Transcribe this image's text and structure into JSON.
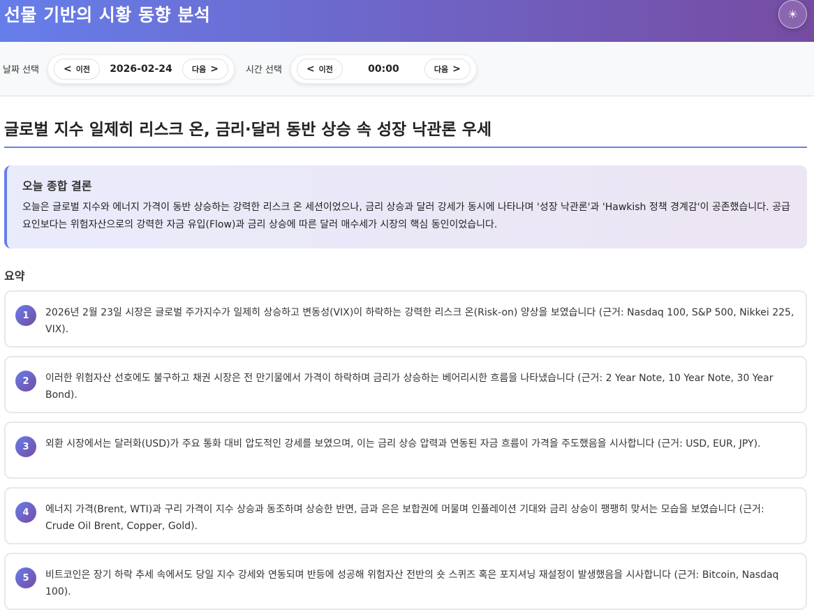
{
  "header": {
    "title": "선물 기반의 시황 동향 분석",
    "theme_icon": "sun-icon"
  },
  "controls": {
    "date_label": "날짜 선택",
    "date_value": "2026-02-24",
    "time_label": "시간 선택",
    "time_value": "00:00",
    "prev": "이전",
    "next": "다음",
    "prev_arrow": "<",
    "next_arrow": ">"
  },
  "main": {
    "title": "글로벌 지수 일제히 리스크 온, 금리·달러 동반 상승 속 성장 낙관론 우세",
    "conclusion": {
      "heading": "오늘 종합 결론",
      "text": "오늘은 글로벌 지수와 에너지 가격이 동반 상승하는 강력한 리스크 온 세션이었으나, 금리 상승과 달러 강세가 동시에 나타나며 '성장 낙관론'과 'Hawkish 정책 경계감'이 공존했습니다. 공급 요인보다는 위험자산으로의 강력한 자금 유입(Flow)과 금리 상승에 따른 달러 매수세가 시장의 핵심 동인이었습니다."
    },
    "summary_title": "요약",
    "summary": [
      {
        "n": "1",
        "text": "2026년 2월 23일 시장은 글로벌 주가지수가 일제히 상승하고 변동성(VIX)이 하락하는 강력한 리스크 온(Risk-on) 양상을 보였습니다 (근거: Nasdaq 100, S&P 500, Nikkei 225, VIX)."
      },
      {
        "n": "2",
        "text": "이러한 위험자산 선호에도 불구하고 채권 시장은 전 만기물에서 가격이 하락하며 금리가 상승하는 베어리시한 흐름을 나타냈습니다 (근거: 2 Year Note, 10 Year Note, 30 Year Bond)."
      },
      {
        "n": "3",
        "text": "외환 시장에서는 달러화(USD)가 주요 통화 대비 압도적인 강세를 보였으며, 이는 금리 상승 압력과 연동된 자금 흐름이 가격을 주도했음을 시사합니다 (근거: USD, EUR, JPY)."
      },
      {
        "n": "4",
        "text": "에너지 가격(Brent, WTI)과 구리 가격이 지수 상승과 동조하며 상승한 반면, 금과 은은 보합권에 머물며 인플레이션 기대와 금리 상승이 팽팽히 맞서는 모습을 보였습니다 (근거: Crude Oil Brent, Copper, Gold)."
      },
      {
        "n": "5",
        "text": "비트코인은 장기 하락 추세 속에서도 당일 지수 강세와 연동되며 반등에 성공해 위험자산 전반의 숏 스퀴즈 혹은 포지셔닝 재설정이 발생했음을 시사합니다 (근거: Bitcoin, Nasdaq 100)."
      }
    ]
  }
}
